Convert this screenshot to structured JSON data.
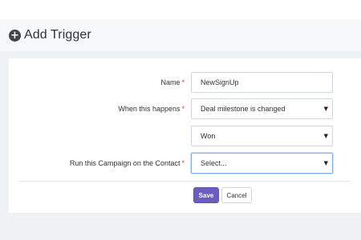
{
  "header": {
    "title": "Add Trigger",
    "icon": "plus-circle-icon"
  },
  "form": {
    "name": {
      "label": "Name",
      "value": "NewSignUp"
    },
    "when": {
      "label": "When this happens",
      "value": "Deal milestone is changed"
    },
    "milestone": {
      "value": "Won"
    },
    "campaign": {
      "label": "Run this Campaign on the Contact",
      "value": "Select..."
    },
    "required_marker": "*"
  },
  "actions": {
    "save_label": "Save",
    "cancel_label": "Cancel"
  },
  "colors": {
    "save_button": "#6a5fc0",
    "required": "#e03b3b",
    "focus_border": "#7fb3e8"
  }
}
